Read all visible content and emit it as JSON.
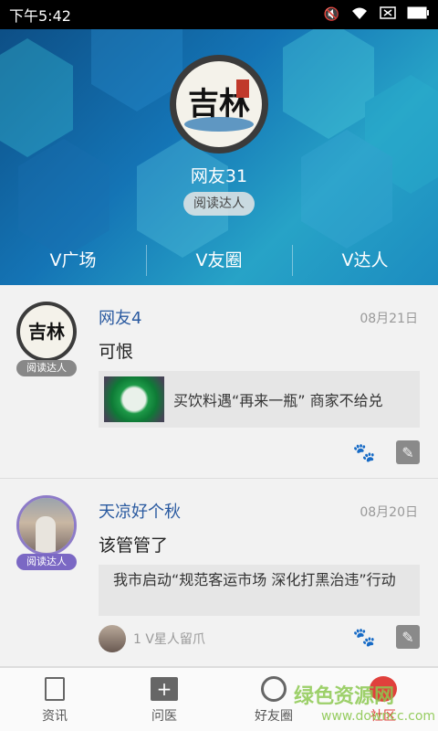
{
  "status_bar": {
    "time": "下午5:42",
    "icons": [
      "mute-icon",
      "wifi-icon",
      "no-sim-icon",
      "battery-icon"
    ]
  },
  "profile": {
    "avatar_text": "吉林",
    "username": "网友31",
    "badge": "阅读达人"
  },
  "tabs": [
    {
      "label": "V广场"
    },
    {
      "label": "V友圈"
    },
    {
      "label": "V达人"
    }
  ],
  "posts": [
    {
      "name": "网友4",
      "date": "08月21日",
      "badge": "阅读达人",
      "text": "可恨",
      "link": "买饮料遇“再来一瓶” 商家不给兑"
    },
    {
      "name": "天凉好个秋",
      "date": "08月20日",
      "badge": "阅读达人",
      "text": "该管管了",
      "link": "我市启动“规范客运市场 深化打黑治违”行动",
      "liker_text": "1 V星人留爪"
    }
  ],
  "bottom_nav": [
    {
      "label": "资讯"
    },
    {
      "label": "问医"
    },
    {
      "label": "好友圈"
    },
    {
      "label": "社区"
    }
  ],
  "watermark": {
    "main": "绿色资源网",
    "sub": "www.downcc.com"
  },
  "colors": {
    "accent": "#e0403c",
    "name_blue": "#2a5aa0",
    "header_blue": "#1474b5"
  }
}
